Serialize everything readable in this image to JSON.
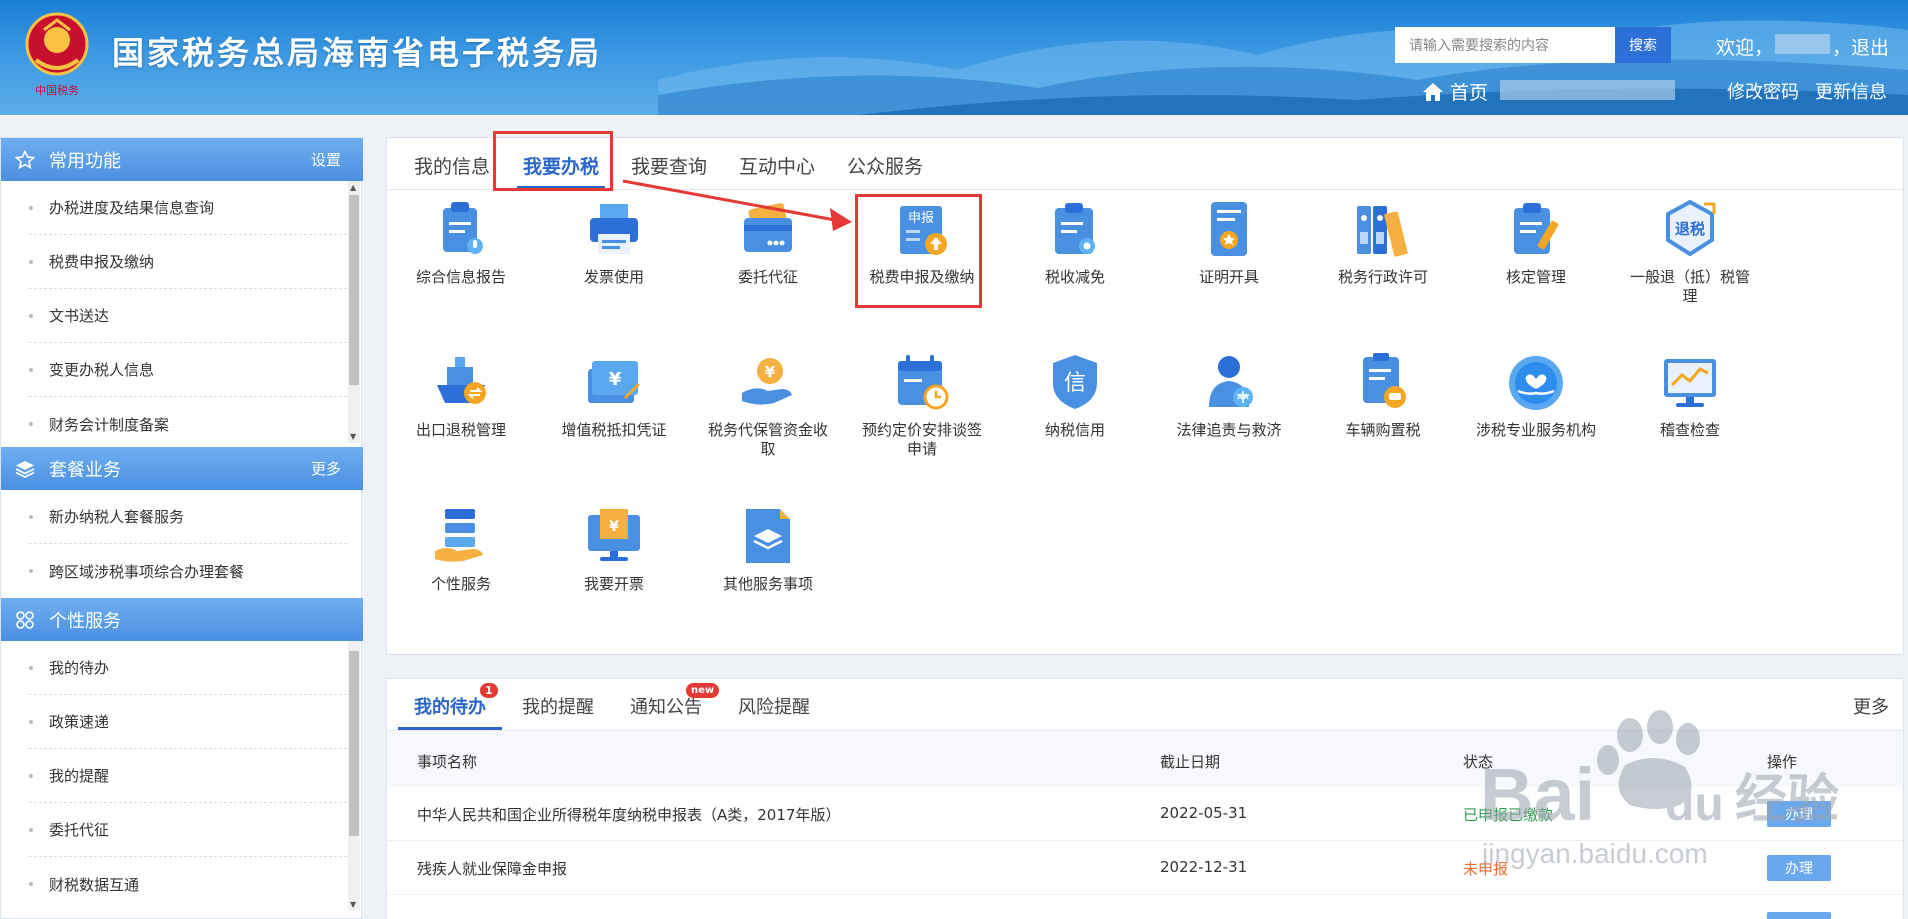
{
  "header": {
    "site_title": "国家税务总局海南省电子税务局",
    "logo_text": "中国税务",
    "search_placeholder": "请输入需要搜索的内容",
    "search_button": "搜索",
    "welcome": "欢迎，",
    "logout": "，退出",
    "home": "首页",
    "change_password": "修改密码",
    "update_info": "更新信息"
  },
  "sidebar": {
    "common": {
      "title": "常用功能",
      "action": "设置",
      "items": [
        "办税进度及结果信息查询",
        "税费申报及缴纳",
        "文书送达",
        "变更办税人信息",
        "财务会计制度备案"
      ]
    },
    "package": {
      "title": "套餐业务",
      "action": "更多",
      "items": [
        "新办纳税人套餐服务",
        "跨区域涉税事项综合办理套餐"
      ]
    },
    "personal": {
      "title": "个性服务",
      "items": [
        "我的待办",
        "政策速递",
        "我的提醒",
        "委托代征",
        "财税数据互通"
      ]
    }
  },
  "main": {
    "tabs": [
      "我的信息",
      "我要办税",
      "我要查询",
      "互动中心",
      "公众服务"
    ],
    "active_tab": "我要办税",
    "services": [
      {
        "label": "综合信息报告",
        "icon": "report-icon"
      },
      {
        "label": "发票使用",
        "icon": "printer-icon"
      },
      {
        "label": "委托代征",
        "icon": "card-icon"
      },
      {
        "label": "税费申报及缴纳",
        "icon": "declare-upload-icon",
        "icon_text": "申报"
      },
      {
        "label": "税收减免",
        "icon": "clipboard-icon"
      },
      {
        "label": "证明开具",
        "icon": "certificate-icon"
      },
      {
        "label": "税务行政许可",
        "icon": "binders-icon"
      },
      {
        "label": "核定管理",
        "icon": "edit-clipboard-icon"
      },
      {
        "label": "一般退（抵）税管理",
        "icon": "tax-refund-icon",
        "icon_text": "退税"
      },
      {
        "label": "出口退税管理",
        "icon": "ship-icon"
      },
      {
        "label": "增值税抵扣凭证",
        "icon": "voucher-icon",
        "icon_text": "¥"
      },
      {
        "label": "税务代保管资金收取",
        "icon": "hand-coin-icon",
        "icon_text": "¥"
      },
      {
        "label": "预约定价安排谈签申请",
        "icon": "calendar-clock-icon"
      },
      {
        "label": "纳税信用",
        "icon": "credit-shield-icon",
        "icon_text": "信"
      },
      {
        "label": "法律追责与救济",
        "icon": "lawyer-icon"
      },
      {
        "label": "车辆购置税",
        "icon": "vehicle-icon"
      },
      {
        "label": "涉税专业服务机构",
        "icon": "heart-hand-icon"
      },
      {
        "label": "稽查检查",
        "icon": "monitor-chart-icon"
      },
      {
        "label": "个性服务",
        "icon": "personal-service-icon"
      },
      {
        "label": "我要开票",
        "icon": "invoice-screen-icon",
        "icon_text": "¥"
      },
      {
        "label": "其他服务事项",
        "icon": "layers-doc-icon"
      }
    ]
  },
  "todo": {
    "tabs": [
      "我的待办",
      "我的提醒",
      "通知公告",
      "风险提醒"
    ],
    "todo_badge": "1",
    "notice_badge": "new",
    "more": "更多",
    "columns": [
      "事项名称",
      "截止日期",
      "状态",
      "操作"
    ],
    "rows": [
      {
        "name": "中华人民共和国企业所得税年度纳税申报表（A类，2017年版）",
        "deadline": "2022-05-31",
        "status": "已申报已缴款",
        "action": "办理"
      },
      {
        "name": "残疾人就业保障金申报",
        "deadline": "2022-12-31",
        "status": "未申报",
        "action": "办理"
      }
    ]
  },
  "watermark": {
    "brand": "Bai",
    "brand_suffix": "du",
    "product": "经验",
    "url": "jingyan.baidu.com"
  },
  "colors": {
    "accent": "#2a66c9",
    "header": "#1a7fd4",
    "highlight": "#e53935",
    "sidebar_head": "#4a90e2"
  }
}
